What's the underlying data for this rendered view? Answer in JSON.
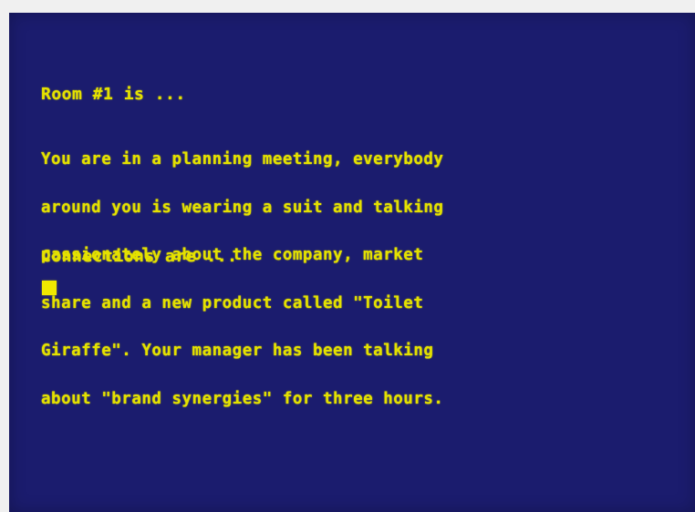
{
  "terminal": {
    "room_heading": "Room #1 is ...",
    "description_lines": [
      "You are in a planning meeting, everybody",
      "around you is wearing a suit and talking",
      "passionately about the company, market",
      "share and a new product called \"Toilet",
      "Giraffe\". Your manager has been talking",
      "about \"brand synergies\" for three hours."
    ],
    "connections_heading": "Connections are ..."
  },
  "colors": {
    "background": "#1b1c6e",
    "text": "#e4e100",
    "cursor": "#f0e800"
  }
}
